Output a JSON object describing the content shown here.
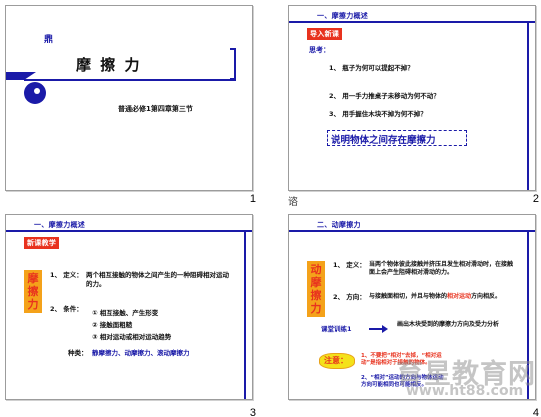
{
  "slide1": {
    "logo_text": "鼎",
    "title": "摩 擦 力",
    "subtitle": "普通必修1第四章第三节",
    "number": "1"
  },
  "slide2": {
    "section": "一、摩擦力概述",
    "tag": "导入新课",
    "think_label": "思考：",
    "questions": [
      "1、 瓶子为何可以提起不掉？",
      "2、 用一手力推桌子未移动为何不动？",
      "3、 用手握住木块不掉为何不掉？"
    ],
    "conclusion": "说明物体之间存在摩擦力",
    "number": "2",
    "caption": "谘"
  },
  "slide3": {
    "section": "一、摩擦力概述",
    "tag": "新课教学",
    "side_label": "摩擦力",
    "def_label": "1、 定义：",
    "def_text": "两个相互接触的物体之间产生的一种阻碍相对运动的力。",
    "cond_label": "2、 条件：",
    "conds": [
      "① 相互接触、产生形变",
      "② 接触面粗糙",
      "③ 相对运动或相对运动趋势"
    ],
    "types_label": "种类：",
    "types": "静摩擦力、动摩擦力、滚动摩擦力",
    "number": "3"
  },
  "slide4": {
    "section": "二、动摩擦力",
    "side_label": "动摩擦力",
    "def_label": "1、 定义：",
    "def_text": "当两个物体彼此接触并挤压且发生相对滑动时，在接触面上会产生阻碍相对滑动的力。",
    "dir_label": "2、 方向：",
    "dir_text_a": "与接触面相切，并且与物体的",
    "dir_text_hl": "相对运动",
    "dir_text_b": "方向相反。",
    "exp_label": "课堂训练1",
    "exp_text": "画出木块受到的摩擦力方向及受力分析",
    "note_label": "注意：",
    "note1": "1、不要把“相对”去掉，“相对运动”是指相对于接触的物体。",
    "note2": "2、“相对”运动的方向与物体运动方向可能相同也可能相反。",
    "number": "4"
  },
  "watermark": {
    "cn": "育星教育网",
    "url": "www.ht88.com"
  },
  "colors": {
    "blue": "#1a1aa8",
    "red": "#e8321e",
    "orange": "#f4a21a"
  }
}
